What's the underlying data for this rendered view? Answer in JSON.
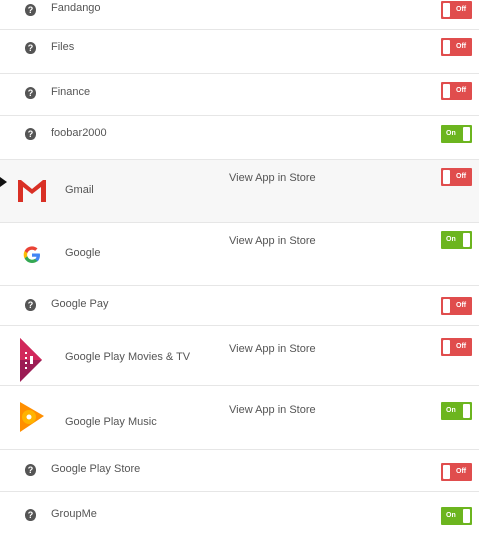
{
  "apps": [
    {
      "name": "Fandango",
      "toggle": "Off",
      "store_link": ""
    },
    {
      "name": "Files",
      "toggle": "Off",
      "store_link": ""
    },
    {
      "name": "Finance",
      "toggle": "Off",
      "store_link": ""
    },
    {
      "name": "foobar2000",
      "toggle": "On",
      "store_link": ""
    },
    {
      "name": "Gmail",
      "toggle": "Off",
      "store_link": "View App in Store",
      "icon": "gmail-icon"
    },
    {
      "name": "Google",
      "toggle": "On",
      "store_link": "View App in Store",
      "icon": "google-icon"
    },
    {
      "name": "Google Pay",
      "toggle": "Off",
      "store_link": ""
    },
    {
      "name": "Google Play Movies & TV",
      "toggle": "Off",
      "store_link": "View App in Store",
      "icon": "play-movies-icon"
    },
    {
      "name": "Google Play Music",
      "toggle": "On",
      "store_link": "View App in Store",
      "icon": "play-music-icon"
    },
    {
      "name": "Google Play Store",
      "toggle": "Off",
      "store_link": ""
    },
    {
      "name": "GroupMe",
      "toggle": "On",
      "store_link": ""
    }
  ],
  "colors": {
    "off": "#e04d4d",
    "on": "#6cb51f",
    "accent": "#8fcf3c"
  }
}
